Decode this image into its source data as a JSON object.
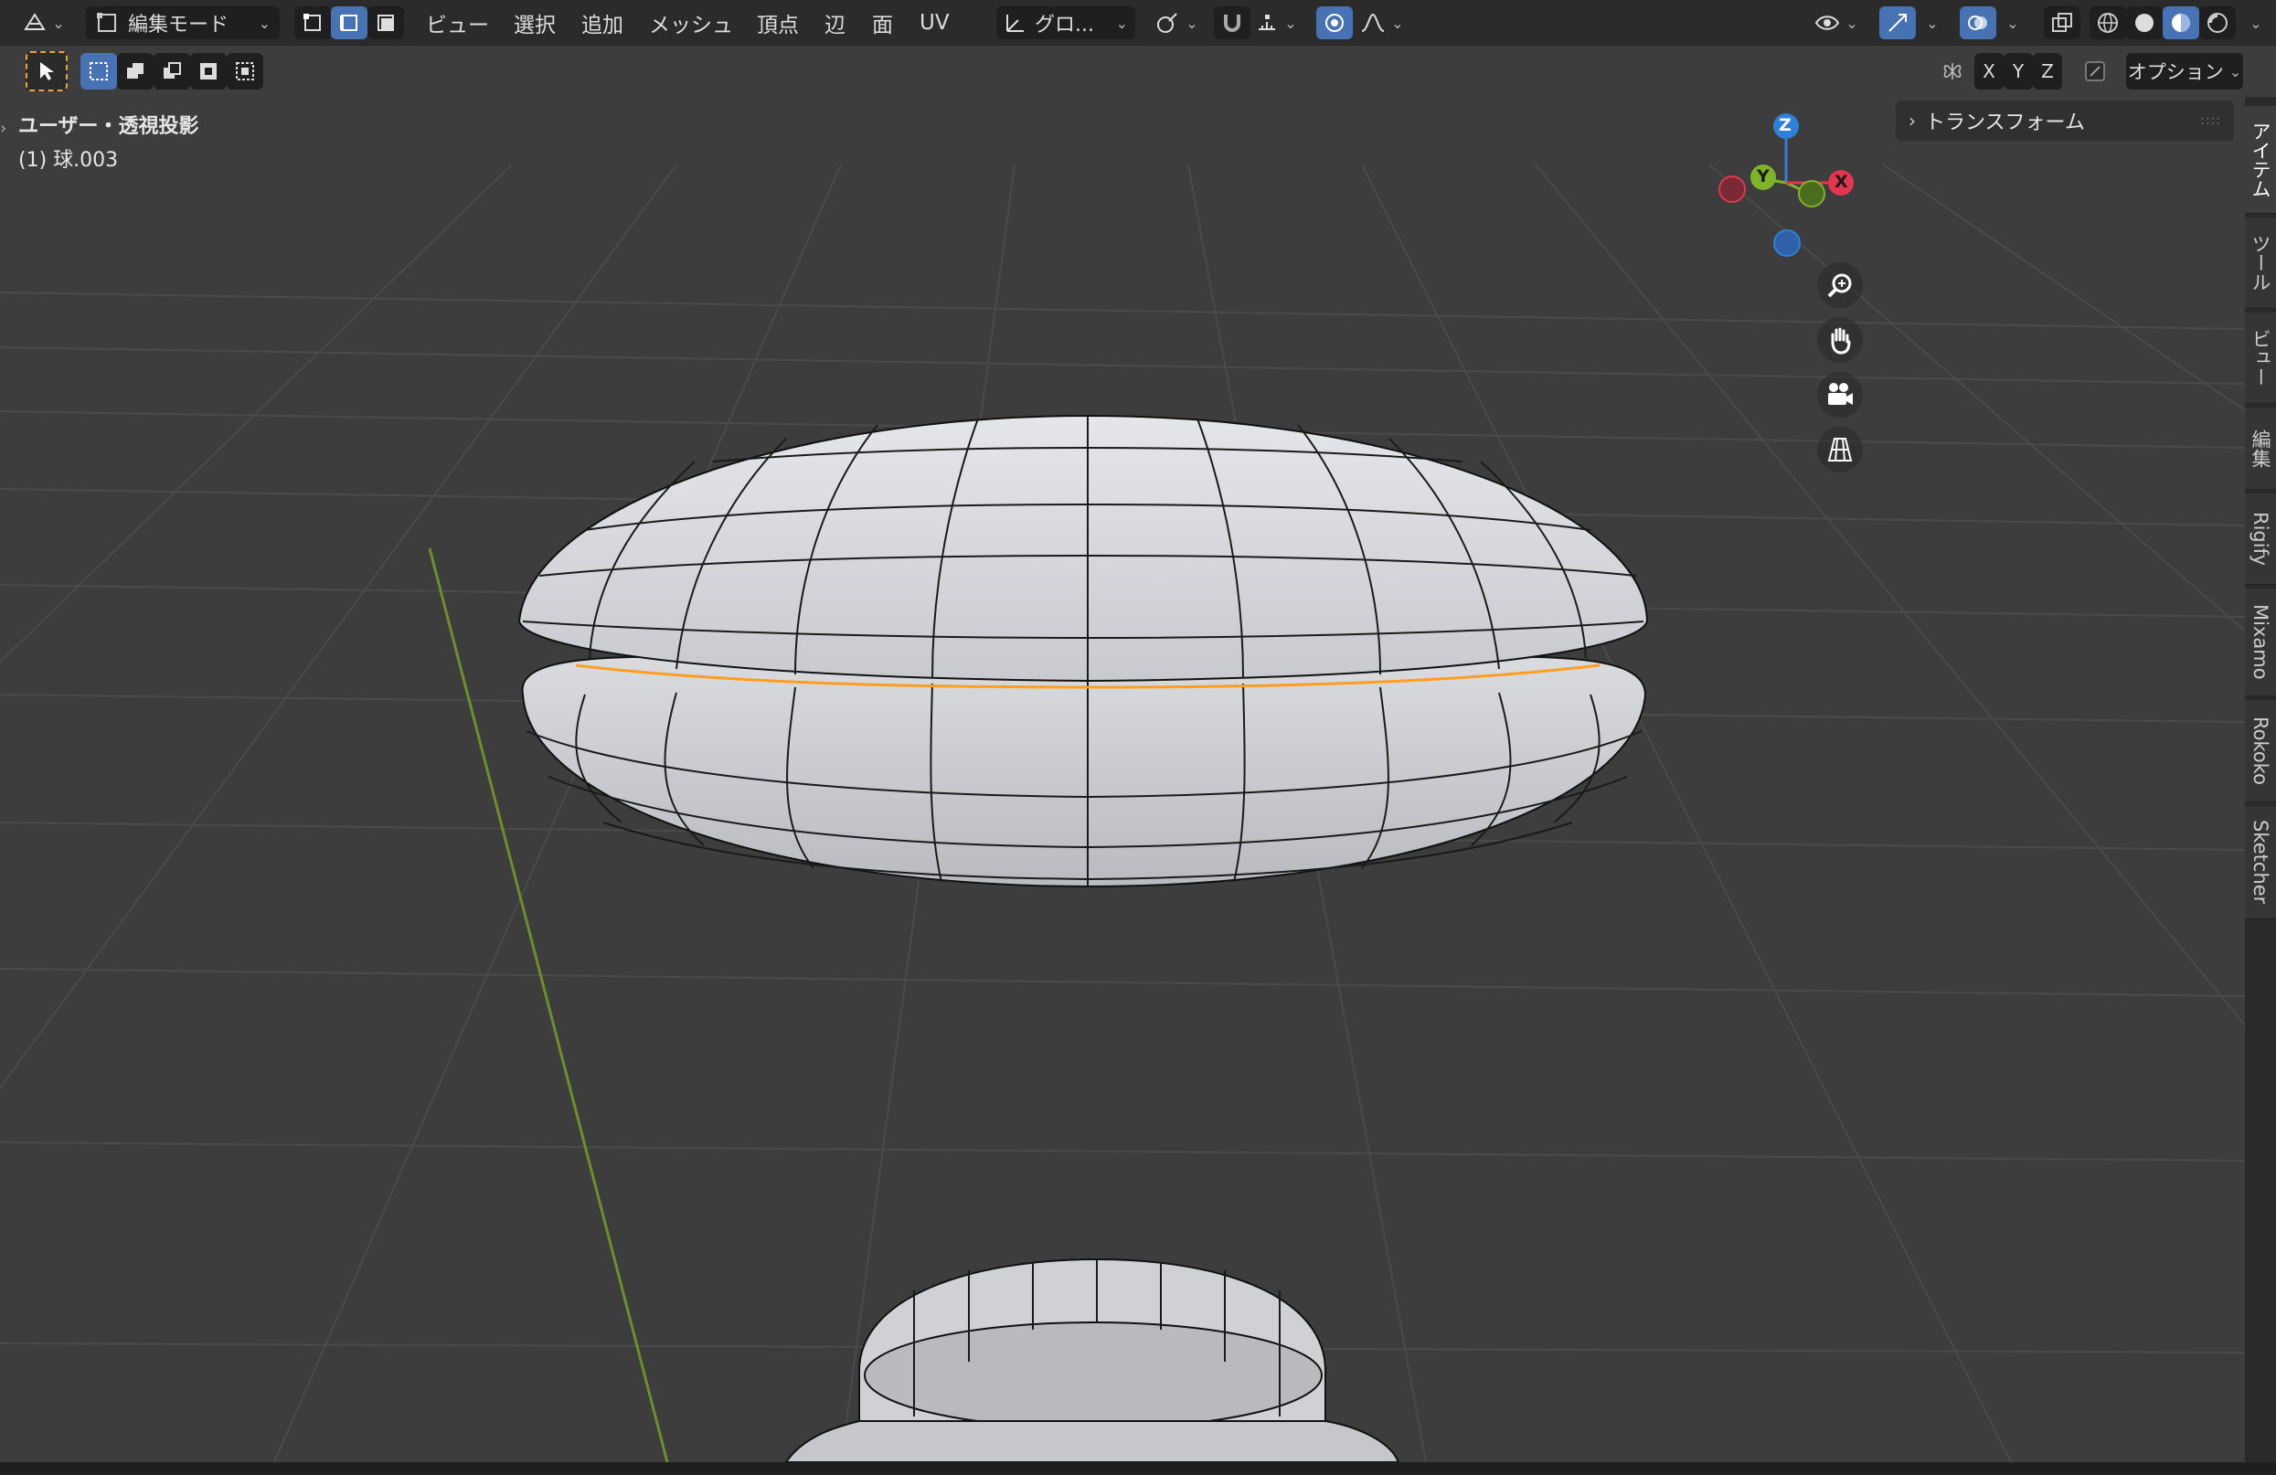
{
  "header": {
    "mode": "編集モード",
    "menus": [
      "ビュー",
      "選択",
      "追加",
      "メッシュ",
      "頂点",
      "辺",
      "面",
      "UV"
    ],
    "transform_orientation": "グロ...",
    "options_label": "オプション",
    "axes": [
      "X",
      "Y",
      "Z"
    ]
  },
  "viewport": {
    "view_label": "ユーザー・透視投影",
    "object_label": "(1) 球.003"
  },
  "gizmo": {
    "x": "X",
    "y": "Y",
    "z": "Z"
  },
  "npanel": {
    "section": "トランスフォーム"
  },
  "tabs": [
    "アイテム",
    "ツール",
    "ビュー",
    "編集",
    "Rigify",
    "Mixamo",
    "Rokoko",
    "Sketcher"
  ],
  "colors": {
    "header_bg": "#2b2b2b",
    "viewport_bg": "#3d3d3d",
    "accent_blue": "#4772b3",
    "axis_x": "#e2374f",
    "axis_y": "#7fb32a",
    "axis_z": "#2f80d8",
    "selected_edge": "#ff9e1f"
  }
}
